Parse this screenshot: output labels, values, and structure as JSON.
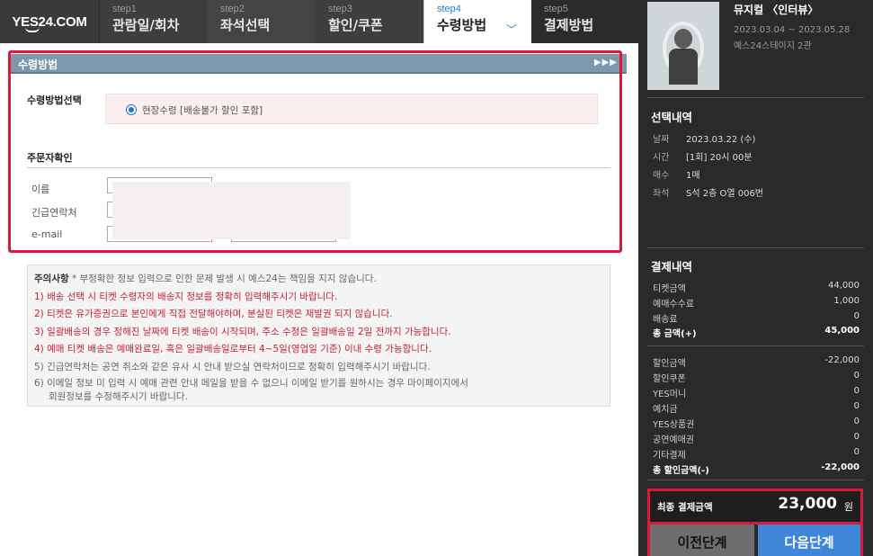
{
  "header": {
    "logo": "YES24.COM",
    "steps": [
      {
        "num": "step1",
        "label": "관람일/회차"
      },
      {
        "num": "step2",
        "label": "좌석선택"
      },
      {
        "num": "step3",
        "label": "할인/쿠폰"
      },
      {
        "num": "step4",
        "label": "수령방법"
      },
      {
        "num": "step5",
        "label": "결제방법"
      }
    ],
    "active_step": 4
  },
  "main": {
    "section_title": "수령방법",
    "section_arrows": "▶▶▶",
    "receive_label": "수령방법선택",
    "receive_option": "현장수령 [배송불가 할인 포함]",
    "order_label": "주문자확인",
    "fields": {
      "name": "이름",
      "phone": "긴급연락처",
      "email": "e-mail"
    },
    "notes": {
      "head": "주의사항",
      "head_sub": "* 부정확한 정보 입력으로 인한 문제 발생 시 예스24는 책임을 지지 않습니다.",
      "items": [
        {
          "text": "1) 배송 선택 시 티켓 수령자의 배송지 정보를 정확히 입력해주시기 바랍니다.",
          "tone": "red"
        },
        {
          "text": "2) 티켓은 유가증권으로 본인에게 직접 전달해야하며, 분실된 티켓은 재발권 되지 않습니다.",
          "tone": "red"
        },
        {
          "text": "3) 일괄배송의 경우 정해진 날짜에 티켓 배송이 시작되며, 주소 수정은 일괄배송일 2일 전까지 가능합니다.",
          "tone": "red"
        },
        {
          "text": "4) 예매 티켓 배송은 예매완료일, 혹은 일괄배송일로부터 4~5일(영업일 기준) 이내 수령 가능합니다.",
          "tone": "red"
        },
        {
          "text": "5) 긴급연락처는 공연 취소와 같은 유사 시 안내 받으실 연락처이므로 정확히 입력해주시기 바랍니다.",
          "tone": "gray"
        },
        {
          "text": "6) 이메일 정보 미 입력 시 예매 관련 안내 메일을 받을 수 없으니 이메일 받기를 원하시는 경우 마이페이지에서",
          "tone": "gray"
        },
        {
          "text": "회원정보를 수정해주시기 바랍니다.",
          "tone": "gray"
        }
      ]
    }
  },
  "sidebar": {
    "show_title": "뮤지컬 〈인터뷰〉",
    "show_period": "2023.03.04 ~ 2023.05.28",
    "show_venue": "예스24스테이지 2관",
    "selection_title": "선택내역",
    "selection": [
      {
        "key": "날짜",
        "value": "2023.03.22 (수)"
      },
      {
        "key": "시간",
        "value": "[1회] 20시 00분"
      },
      {
        "key": "매수",
        "value": "1매"
      },
      {
        "key": "좌석",
        "value": "S석 2층 O열 006번"
      }
    ],
    "payment_title": "결제내역",
    "payment": [
      {
        "key": "티켓금액",
        "value": "44,000",
        "bold": false
      },
      {
        "key": "예매수수료",
        "value": "1,000",
        "bold": false
      },
      {
        "key": "배송료",
        "value": "0",
        "bold": false
      },
      {
        "key": "총 금액(+)",
        "value": "45,000",
        "bold": true
      }
    ],
    "discount": [
      {
        "key": "할인금액",
        "value": "-22,000",
        "bold": false
      },
      {
        "key": "할인쿠폰",
        "value": "0",
        "bold": false
      },
      {
        "key": "YES머니",
        "value": "0",
        "bold": false
      },
      {
        "key": "예치금",
        "value": "0",
        "bold": false
      },
      {
        "key": "YES상품권",
        "value": "0",
        "bold": false
      },
      {
        "key": "공연예매권",
        "value": "0",
        "bold": false
      },
      {
        "key": "기타결제",
        "value": "0",
        "bold": false
      },
      {
        "key": "총 할인금액(-)",
        "value": "-22,000",
        "bold": true
      }
    ],
    "final_label": "최종 결제금액",
    "final_amount": "23,000",
    "final_unit": "원",
    "prev_button": "이전단계",
    "next_button": "다음단계"
  },
  "colors": {
    "accent_blue": "#3d86d8",
    "highlight_red": "#e0173c",
    "section_head": "#7f97ad"
  }
}
